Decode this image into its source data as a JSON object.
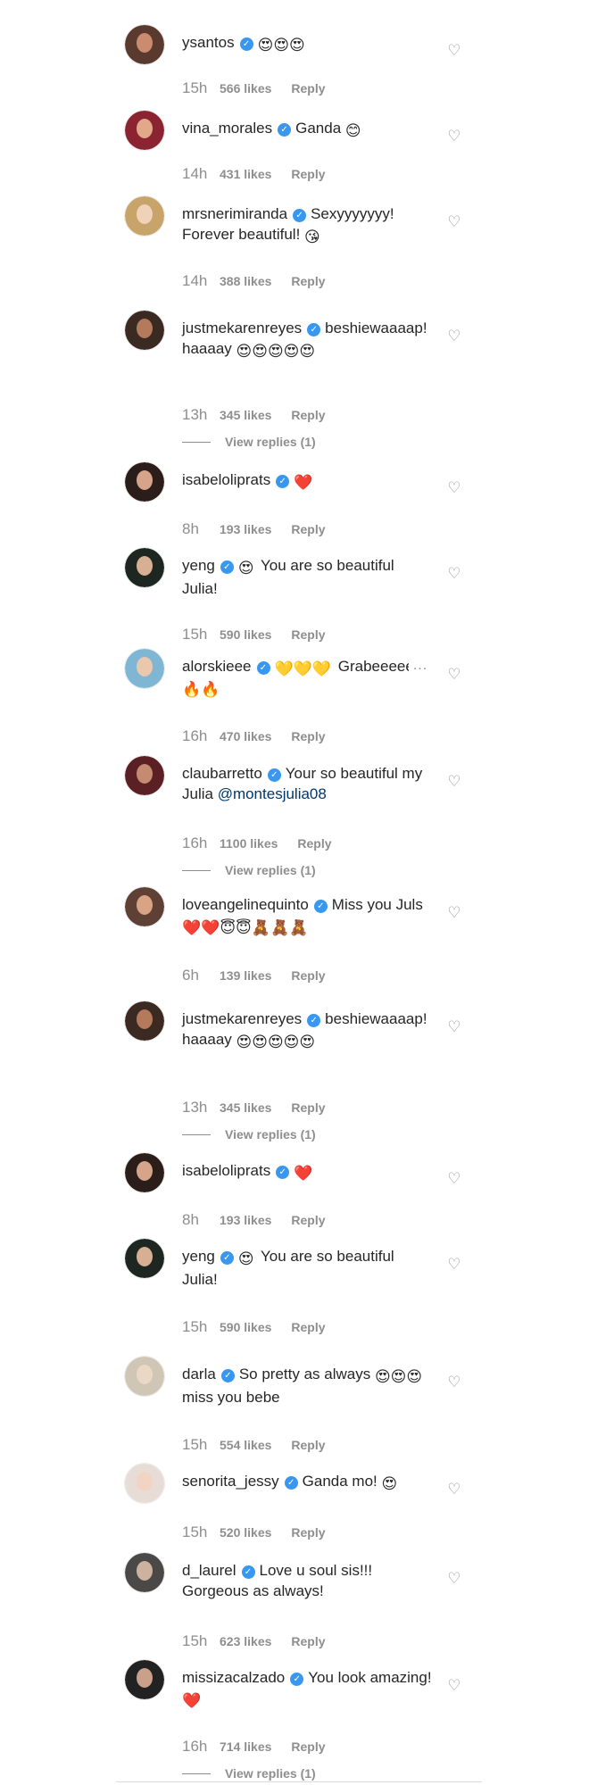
{
  "comments": [
    {
      "username": "ysantos",
      "text": "",
      "emoji_after": "😍😍😍",
      "time": "15h",
      "likes": "566 likes",
      "reply": "Reply",
      "view_replies": "",
      "colors": [
        "#5a3a2e",
        "#c98c6e"
      ]
    },
    {
      "username": "vina_morales",
      "text": "Ganda ",
      "emoji_after": "😊",
      "time": "14h",
      "likes": "431 likes",
      "reply": "Reply",
      "view_replies": "",
      "colors": [
        "#8a2430",
        "#e2a88a"
      ]
    },
    {
      "username": "mrsneri­miranda",
      "text": "Sexyyyyyyy! Forever beautiful! ",
      "emoji_after": "😘",
      "time": "14h",
      "likes": "388 likes",
      "reply": "Reply",
      "view_replies": "",
      "colors": [
        "#c9a46a",
        "#f0d2b8"
      ]
    },
    {
      "username": "justmekarenreyes",
      "text": "beshiewaaaap! haaaay ",
      "emoji_after": "😍😍😍😍😍",
      "time": "13h",
      "likes": "345 likes",
      "reply": "Reply",
      "view_replies": "View replies (1)",
      "colors": [
        "#3a2a22",
        "#b47a5c"
      ]
    },
    {
      "username": "isabeloliprats",
      "text": "",
      "emoji_after": "❤️",
      "time": "8h",
      "likes": "193 likes",
      "reply": "Reply",
      "view_replies": "",
      "colors": [
        "#2b1e1a",
        "#d6a48a"
      ]
    },
    {
      "username": "yeng",
      "text": "",
      "emoji_after": "😍",
      "text_after": " You are so beautiful Julia!",
      "time": "15h",
      "likes": "590 likes",
      "reply": "Reply",
      "view_replies": "",
      "colors": [
        "#1d2620",
        "#d7b094"
      ]
    },
    {
      "username": "alorskieee",
      "text": "",
      "emoji_after": "💛💛💛",
      "text_after": " Grabeeeeeee 🔥🔥",
      "time": "16h",
      "likes": "470 likes",
      "reply": "Reply",
      "view_replies": "",
      "ellipsis": "...",
      "colors": [
        "#7fb6d4",
        "#e9c8ae"
      ]
    },
    {
      "username": "claubarretto",
      "text": "Your so beautiful my Julia ",
      "mention": "@montesjulia08",
      "emoji_after": "",
      "time": "16h",
      "likes": "1100 likes",
      "reply": "Reply",
      "view_replies": "View replies (1)",
      "colors": [
        "#5a2024",
        "#c48a72"
      ]
    },
    {
      "username": "loveangelinequinto",
      "text": "Miss you Juls",
      "emoji_after": "❤️❤️😇😇🧸🧸🧸",
      "time": "6h",
      "likes": "139 likes",
      "reply": "Reply",
      "view_replies": "",
      "colors": [
        "#5e4034",
        "#d9a486"
      ]
    },
    {
      "username": "justmekarenreyes",
      "text": "beshiewaaaap! haaaay ",
      "emoji_after": "😍😍😍😍😍",
      "time": "13h",
      "likes": "345 likes",
      "reply": "Reply",
      "view_replies": "View replies (1)",
      "colors": [
        "#3a2a22",
        "#b47a5c"
      ]
    },
    {
      "username": "isabeloliprats",
      "text": "",
      "emoji_after": "❤️",
      "time": "8h",
      "likes": "193 likes",
      "reply": "Reply",
      "view_replies": "",
      "colors": [
        "#2b1e1a",
        "#d6a48a"
      ]
    },
    {
      "username": "yeng",
      "text": "",
      "emoji_after": "😍",
      "text_after": " You are so beautiful Julia!",
      "time": "15h",
      "likes": "590 likes",
      "reply": "Reply",
      "view_replies": "",
      "colors": [
        "#1d2620",
        "#d7b094"
      ]
    },
    {
      "username": "darla",
      "text": "So pretty as always ",
      "emoji_after": "😍😍😍",
      "text_after": " miss you bebe",
      "time": "15h",
      "likes": "554 likes",
      "reply": "Reply",
      "view_replies": "",
      "colors": [
        "#cfc6b6",
        "#ead8c4"
      ]
    },
    {
      "username": "senorita_jessy",
      "text": "Ganda mo! ",
      "emoji_after": "😍",
      "time": "15h",
      "likes": "520 likes",
      "reply": "Reply",
      "view_replies": "",
      "colors": [
        "#e7dcd6",
        "#f1d4c2"
      ]
    },
    {
      "username": "d_laurel",
      "text": "Love u soul sis!!! Gorgeous as always!",
      "emoji_after": "",
      "time": "15h",
      "likes": "623 likes",
      "reply": "Reply",
      "view_replies": "",
      "colors": [
        "#4b4848",
        "#cdb2a0"
      ]
    },
    {
      "username": "missizacalzado",
      "text": "You look amazing! ",
      "emoji_after": "❤️",
      "time": "16h",
      "likes": "714 likes",
      "reply": "Reply",
      "view_replies": "View replies (1)",
      "colors": [
        "#222222",
        "#c9a08a"
      ]
    }
  ],
  "icons": {
    "verified": "verified-badge-icon",
    "like": "heart-outline-icon"
  },
  "accent_colors": {
    "verified": "#3897f0",
    "meta": "#8e8e8e",
    "mention": "#00376b"
  }
}
